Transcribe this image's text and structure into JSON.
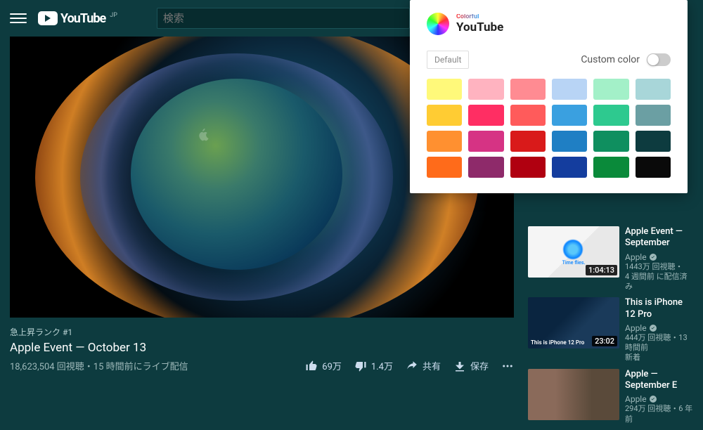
{
  "header": {
    "logo_text": "YouTube",
    "region": "JP",
    "search_placeholder": "検索"
  },
  "video": {
    "trending": "急上昇ランク #1",
    "title": "Apple Event — October 13",
    "stats": "18,623,504 回視聴・15 時間前にライブ配信",
    "like_count": "69万",
    "dislike_count": "1.4万",
    "share_label": "共有",
    "save_label": "保存"
  },
  "sidebar": [
    {
      "title": "Apple Event — September",
      "channel": "Apple",
      "views": "1443万 回視聴・",
      "time": "4 週間前 に配信済み",
      "duration": "1:04:13",
      "caption": "Time flies."
    },
    {
      "title": "This is iPhone 12 Pro",
      "channel": "Apple",
      "views": "444万 回視聴・13 時間前",
      "time": "新着",
      "duration": "23:02",
      "caption": "This is iPhone 12 Pro"
    },
    {
      "title": "Apple — September E",
      "channel": "Apple",
      "views": "294万 回視聴・6 年前",
      "time": "",
      "duration": ""
    }
  ],
  "popup": {
    "brand_colorful": "Colorful",
    "brand_youtube": "YouTube",
    "default_label": "Default",
    "custom_label": "Custom color",
    "swatches": [
      "#fff97a",
      "#ffb3c0",
      "#ff8b92",
      "#b8d4f5",
      "#a3f0c8",
      "#a8d6d9",
      "#ffcc33",
      "#ff2e63",
      "#ff5b5b",
      "#3aa0e0",
      "#2ec98f",
      "#6b9fa3",
      "#ff9030",
      "#d63384",
      "#d91a1a",
      "#1f7fc4",
      "#0f8f5f",
      "#0d3b3f",
      "#ff6b1a",
      "#8e2a6a",
      "#b00010",
      "#143d9e",
      "#0a8a3a",
      "#0a0a0a"
    ]
  }
}
